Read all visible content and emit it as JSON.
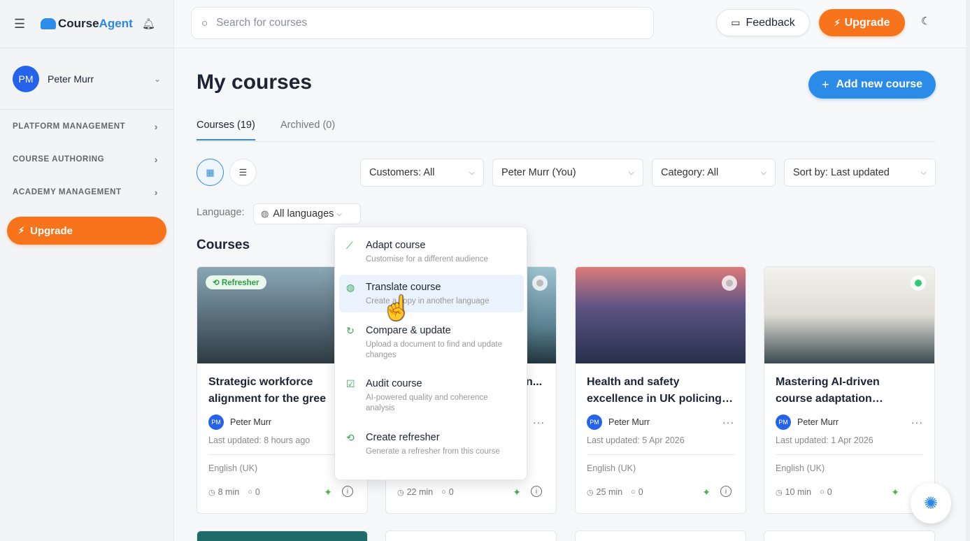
{
  "brand": {
    "logo_text_course": "Course",
    "logo_text_agent": "Agent"
  },
  "user": {
    "initials": "PM",
    "name": "Peter Murr"
  },
  "sidebar": {
    "items": [
      {
        "label": "PLATFORM MANAGEMENT"
      },
      {
        "label": "COURSE AUTHORING"
      },
      {
        "label": "ACADEMY MANAGEMENT"
      }
    ],
    "upgrade_label": "Upgrade"
  },
  "topbar": {
    "search_placeholder": "Search for courses",
    "feedback_label": "Feedback",
    "upgrade_label": "Upgrade"
  },
  "page": {
    "title": "My courses",
    "add_label": "Add new course",
    "section_title": "Courses"
  },
  "tabs": [
    {
      "label": "Courses (19)"
    },
    {
      "label": "Archived (0)"
    }
  ],
  "filters": {
    "customers": "Customers: All",
    "owner": "Peter Murr (You)",
    "category": "Category: All",
    "sort": "Sort by: Last updated",
    "language_label": "Language:",
    "language_value": "All languages"
  },
  "cards": [
    {
      "badge": "Refresher",
      "title": "Strategic workforce\nalignment for the gree",
      "author": "Peter Murr",
      "updated": "Last updated: 8 hours ago",
      "language": "English (UK)",
      "duration": "8 min",
      "comments": "0"
    },
    {
      "title": "",
      "author": "",
      "updated": "",
      "language": "",
      "duration": "22 min",
      "comments": "0"
    },
    {
      "title": "Health and safety\nexcellence in UK policing…",
      "author": "Peter Murr",
      "updated": "Last updated: 5 Apr 2026",
      "language": "English (UK)",
      "duration": "25 min",
      "comments": "0"
    },
    {
      "title": "Mastering AI-driven\ncourse adaptation…",
      "author": "Peter Murr",
      "updated": "Last updated: 1 Apr 2026",
      "language": "English (UK)",
      "duration": "10 min",
      "comments": "0"
    }
  ],
  "card2_partial": {
    "title_tail": "n...",
    "more": "···"
  },
  "menu": {
    "items": [
      {
        "title": "Adapt course",
        "desc": "Customise for a different audience"
      },
      {
        "title": "Translate course",
        "desc": "Create a copy in another language"
      },
      {
        "title": "Compare & update",
        "desc": "Upload a document to find and update changes"
      },
      {
        "title": "Audit course",
        "desc": "AI-powered quality and coherence analysis"
      },
      {
        "title": "Create refresher",
        "desc": "Generate a refresher from this course"
      }
    ]
  },
  "colors": {
    "accent": "#2b8be8",
    "upgrade": "#f7731c",
    "avatar": "#2563eb",
    "ai_green": "#4caf50"
  }
}
